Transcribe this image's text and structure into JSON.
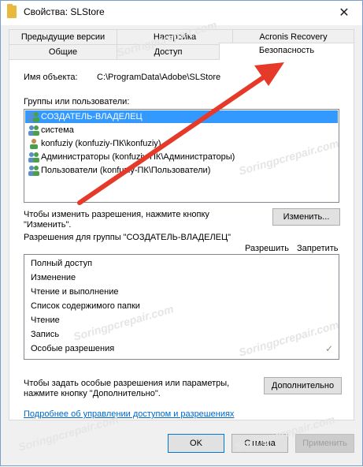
{
  "window": {
    "title": "Свойства: SLStore",
    "close_glyph": "✕"
  },
  "tabs_row1": [
    {
      "label": "Предыдущие версии"
    },
    {
      "label": "Настройка"
    },
    {
      "label": "Acronis Recovery"
    }
  ],
  "tabs_row2": [
    {
      "label": "Общие"
    },
    {
      "label": "Доступ"
    },
    {
      "label": "Безопасность",
      "active": true
    }
  ],
  "object": {
    "label": "Имя объекта:",
    "value": "C:\\ProgramData\\Adobe\\SLStore"
  },
  "groups": {
    "label": "Группы или пользователи:",
    "items": [
      {
        "label": "СОЗДАТЕЛЬ-ВЛАДЕЛЕЦ",
        "icon": "users-group-icon",
        "selected": true
      },
      {
        "label": "система",
        "icon": "users-group-icon"
      },
      {
        "label": "konfuziy (konfuziy-ПК\\konfuziy)",
        "icon": "user-icon"
      },
      {
        "label": "Администраторы (konfuziy-ПК\\Администраторы)",
        "icon": "users-group-icon"
      },
      {
        "label": "Пользователи (konfuziy-ПК\\Пользователи)",
        "icon": "users-group-icon"
      }
    ]
  },
  "change": {
    "text_line1": "Чтобы изменить разрешения, нажмите кнопку",
    "text_line2": "\"Изменить\".",
    "button": "Изменить..."
  },
  "permissions": {
    "label": "Разрешения для группы \"СОЗДАТЕЛЬ-ВЛАДЕЛЕЦ\"",
    "allow_header": "Разрешить",
    "deny_header": "Запретить",
    "items": [
      {
        "label": "Полный доступ",
        "allow": false
      },
      {
        "label": "Изменение",
        "allow": false
      },
      {
        "label": "Чтение и выполнение",
        "allow": false
      },
      {
        "label": "Список содержимого папки",
        "allow": false
      },
      {
        "label": "Чтение",
        "allow": false
      },
      {
        "label": "Запись",
        "allow": false
      },
      {
        "label": "Особые разрешения",
        "allow": true
      }
    ],
    "check_glyph": "✓"
  },
  "advanced": {
    "text_line1": "Чтобы задать особые разрешения или параметры,",
    "text_line2": "нажмите кнопку \"Дополнительно\".",
    "button": "Дополнительно"
  },
  "link": "Подробнее об управлении доступом и разрешениях",
  "footer": {
    "ok": "OK",
    "cancel": "Отмена",
    "apply": "Применить"
  },
  "watermark": "Soringpcrepair.com",
  "colors": {
    "selection": "#3399ff",
    "link": "#0066cc",
    "arrow": "#e53a2a",
    "window_border": "#7a9ec9"
  }
}
